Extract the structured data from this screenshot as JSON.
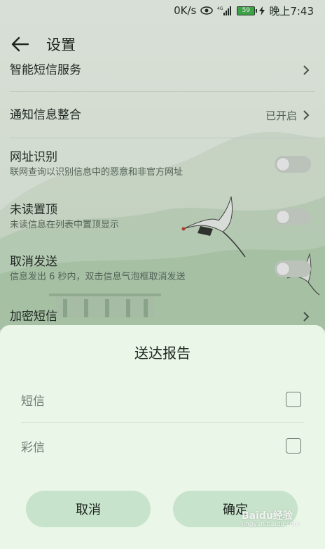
{
  "status_bar": {
    "network_speed": "0K/s",
    "signal_label": "4G",
    "battery_level": "59",
    "time": "晚上7:43"
  },
  "header": {
    "back_icon": "arrow-left-icon",
    "title": "设置"
  },
  "settings": [
    {
      "title": "智能短信服务",
      "subtitle": "",
      "control": "chevron",
      "value": ""
    },
    {
      "title": "通知信息整合",
      "subtitle": "",
      "control": "chevron",
      "value": "已开启"
    },
    {
      "title": "网址识别",
      "subtitle": "联网查询以识别信息中的恶意和非官方网址",
      "control": "toggle",
      "state": "off"
    },
    {
      "title": "未读置顶",
      "subtitle": "未读信息在列表中置顶显示",
      "control": "toggle",
      "state": "off"
    },
    {
      "title": "取消发送",
      "subtitle": "信息发出 6 秒内，双击信息气泡框取消发送",
      "control": "toggle",
      "state": "off"
    },
    {
      "title": "加密短信",
      "subtitle": "",
      "control": "chevron",
      "value": ""
    }
  ],
  "dialog": {
    "title": "送达报告",
    "options": [
      {
        "label": "短信",
        "checked": false
      },
      {
        "label": "彩信",
        "checked": false
      }
    ],
    "cancel_label": "取消",
    "confirm_label": "确定"
  },
  "watermark": {
    "text": "Baidu经验",
    "sub": "jingyan.baidu.com"
  },
  "colors": {
    "background": "#eef5ec",
    "dialog": "#e9f6e8",
    "button": "#c8e3cb",
    "toggle_off": "#cfd6cf"
  }
}
